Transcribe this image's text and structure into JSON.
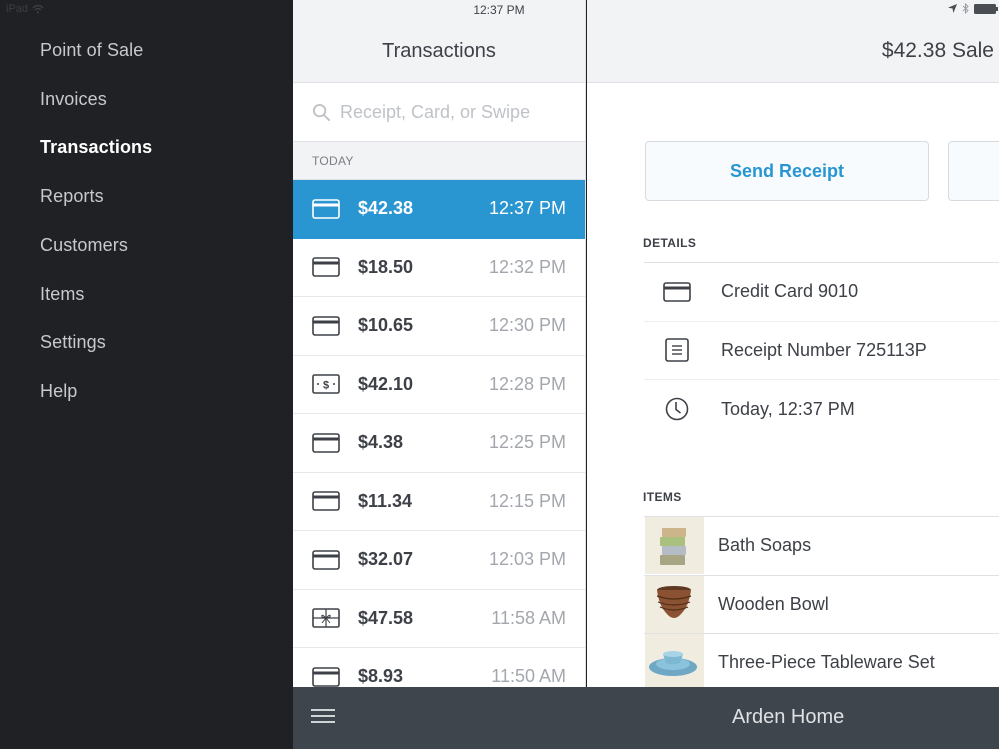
{
  "status_bar": {
    "device": "iPad",
    "time": "12:37 PM"
  },
  "sidebar": {
    "items": [
      {
        "label": "Point of Sale",
        "active": false
      },
      {
        "label": "Invoices",
        "active": false
      },
      {
        "label": "Transactions",
        "active": true
      },
      {
        "label": "Reports",
        "active": false
      },
      {
        "label": "Customers",
        "active": false
      },
      {
        "label": "Items",
        "active": false
      },
      {
        "label": "Settings",
        "active": false
      },
      {
        "label": "Help",
        "active": false
      }
    ]
  },
  "transactions": {
    "title": "Transactions",
    "search_placeholder": "Receipt, Card, or Swipe",
    "search_value": "",
    "section": "TODAY",
    "rows": [
      {
        "icon": "credit-card-icon",
        "amount": "$42.38",
        "time": "12:37 PM",
        "selected": true
      },
      {
        "icon": "credit-card-icon",
        "amount": "$18.50",
        "time": "12:32 PM",
        "selected": false
      },
      {
        "icon": "credit-card-icon",
        "amount": "$10.65",
        "time": "12:30 PM",
        "selected": false
      },
      {
        "icon": "cash-icon",
        "amount": "$42.10",
        "time": "12:28 PM",
        "selected": false
      },
      {
        "icon": "credit-card-icon",
        "amount": "$4.38",
        "time": "12:25 PM",
        "selected": false
      },
      {
        "icon": "credit-card-icon",
        "amount": "$11.34",
        "time": "12:15 PM",
        "selected": false
      },
      {
        "icon": "credit-card-icon",
        "amount": "$32.07",
        "time": "12:03 PM",
        "selected": false
      },
      {
        "icon": "gift-card-icon",
        "amount": "$47.58",
        "time": "11:58 AM",
        "selected": false
      },
      {
        "icon": "credit-card-icon",
        "amount": "$8.93",
        "time": "11:50 AM",
        "selected": false
      }
    ]
  },
  "detail": {
    "title": "$42.38 Sale",
    "send_receipt_label": "Send Receipt",
    "details_label": "DETAILS",
    "details": [
      {
        "icon": "credit-card-icon",
        "text": "Credit Card 9010"
      },
      {
        "icon": "receipt-icon",
        "text": "Receipt Number 725113P"
      },
      {
        "icon": "clock-icon",
        "text": "Today, 12:37 PM"
      }
    ],
    "items_label": "ITEMS",
    "items": [
      {
        "thumb": "bath-soaps-thumbnail",
        "name": "Bath Soaps"
      },
      {
        "thumb": "wooden-bowl-thumbnail",
        "name": "Wooden Bowl"
      },
      {
        "thumb": "tableware-thumbnail",
        "name": "Three-Piece Tableware Set"
      }
    ]
  },
  "bottom_bar": {
    "store_name": "Arden Home"
  },
  "colors": {
    "accent": "#2996d1",
    "sidebar_bg": "#1f2125",
    "bottom_bar_bg": "#3e454d",
    "text_primary": "#3d4147",
    "text_secondary": "#a3a7ad"
  }
}
